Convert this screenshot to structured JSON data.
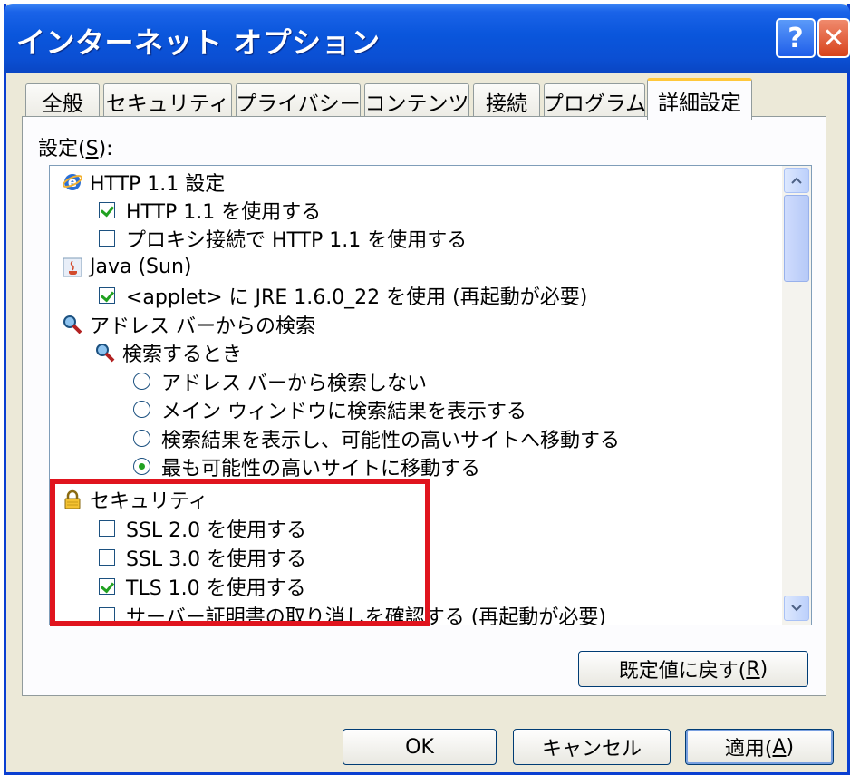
{
  "window": {
    "title": "インターネット オプション",
    "help_glyph": "?",
    "close_glyph": "✕"
  },
  "tabs": [
    {
      "label": "全般"
    },
    {
      "label": "セキュリティ"
    },
    {
      "label": "プライバシー"
    },
    {
      "label": "コンテンツ"
    },
    {
      "label": "接続"
    },
    {
      "label": "プログラム"
    },
    {
      "label": "詳細設定",
      "active": true
    }
  ],
  "settings": {
    "label": "設定(",
    "label_key": "S",
    "label_suffix": "):",
    "items": [
      {
        "type": "category",
        "icon": "ie-icon",
        "text": "HTTP 1.1 設定"
      },
      {
        "type": "checkbox",
        "checked": true,
        "text": "HTTP 1.1 を使用する"
      },
      {
        "type": "checkbox",
        "checked": false,
        "text": "プロキシ接続で HTTP 1.1 を使用する"
      },
      {
        "type": "category",
        "icon": "java-icon",
        "text": "Java (Sun)"
      },
      {
        "type": "checkbox",
        "checked": true,
        "text": "<applet> に JRE 1.6.0_22 を使用 (再起動が必要)"
      },
      {
        "type": "category",
        "icon": "search-icon",
        "text": "アドレス バーからの検索"
      },
      {
        "type": "subcategory",
        "icon": "search-icon",
        "text": "検索するとき"
      },
      {
        "type": "radio",
        "selected": false,
        "text": "アドレス バーから検索しない"
      },
      {
        "type": "radio",
        "selected": false,
        "text": "メイン ウィンドウに検索結果を表示する"
      },
      {
        "type": "radio",
        "selected": false,
        "text": "検索結果を表示し、可能性の高いサイトへ移動する"
      },
      {
        "type": "radio",
        "selected": true,
        "text": "最も可能性の高いサイトに移動する"
      },
      {
        "type": "category",
        "icon": "lock-icon",
        "text": "セキュリティ"
      },
      {
        "type": "checkbox",
        "checked": false,
        "text": "SSL 2.0 を使用する"
      },
      {
        "type": "checkbox",
        "checked": false,
        "text": "SSL 3.0 を使用する"
      },
      {
        "type": "checkbox",
        "checked": true,
        "text": "TLS 1.0 を使用する"
      },
      {
        "type": "checkbox",
        "checked": false,
        "text": "サーバー証明書の取り消しを確認する (再起動が必要)"
      }
    ]
  },
  "restore_button": {
    "label": "既定値に戻す(",
    "key": "R",
    "suffix": ")"
  },
  "footer": {
    "ok": "OK",
    "cancel": "キャンセル",
    "apply": "適用(",
    "apply_key": "A",
    "apply_suffix": ")"
  },
  "colors": {
    "highlight": "#e0141e",
    "title_bar": "#0a56dc",
    "tab_accent": "#ffc83c"
  }
}
